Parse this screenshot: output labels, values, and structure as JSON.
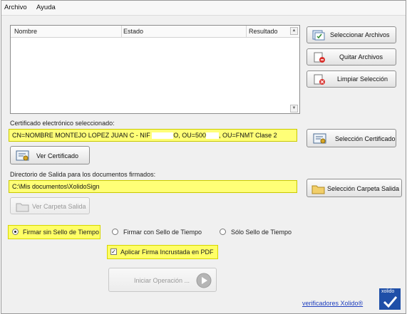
{
  "menu": {
    "file_label": "Archivo",
    "help_label": "Ayuda"
  },
  "table": {
    "columns": [
      "Nombre",
      "Estado",
      "Resultado"
    ],
    "scroll_up_glyph": "▲",
    "scroll_down_glyph": "▼"
  },
  "buttons": {
    "select_files": "Seleccionar Archivos",
    "remove_files": "Quitar Archivos",
    "clear_selection": "Limpiar Selección",
    "select_certificate": "Selección Certificado",
    "view_certificate": "Ver Certificado",
    "select_output_folder": "Selección Carpeta Salida",
    "view_output_folder": "Ver Carpeta Salida",
    "start_operation": "Iniciar Operación ..."
  },
  "certificate": {
    "label": "Certificado electrónico seleccionado:",
    "value": "CN=NOMBRE MONTEJO LOPEZ JUAN C - NIF ",
    "value_suffix": "O, OU=500",
    "value_end": ", OU=FNMT Clase 2"
  },
  "output": {
    "label": "Directorio de Salida para los documentos firmados:",
    "path": "C:\\Mis documentos\\XolidoSign"
  },
  "options": {
    "sign_without_timestamp": "Firmar sin Sello de Tiempo",
    "sign_with_timestamp": "Firmar con Sello de Tiempo",
    "timestamp_only": "Sólo Sello de Tiempo",
    "selected": "sign_without_timestamp",
    "embed_pdf_signature": "Aplicar Firma Incrustada en PDF",
    "embed_pdf_checked": true,
    "check_glyph": "✓"
  },
  "footer": {
    "verifiers_link": "verificadores Xolido®",
    "logo_text": "xolido"
  },
  "colors": {
    "highlight": "#ffff66",
    "link": "#1f3fbf",
    "logo_bg": "#1f4fa8"
  }
}
